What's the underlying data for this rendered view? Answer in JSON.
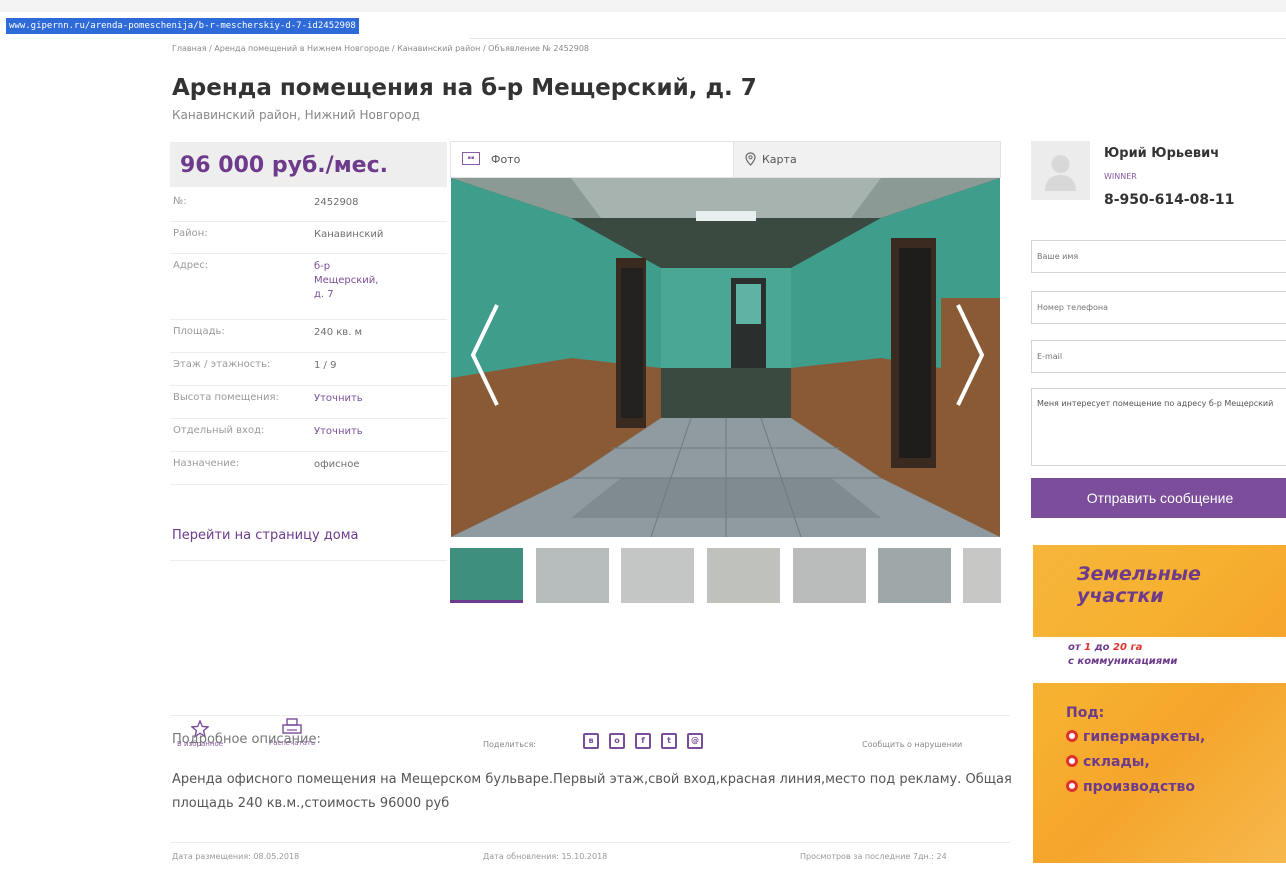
{
  "url": "www.gipernn.ru/arenda-pomeschenija/b-r-mescherskiy-d-7-id2452908",
  "breadcrumb": "Главная / Аренда помещений в Нижнем Новгороде / Канавинский район / Объявление № 2452908",
  "title": "Аренда помещения на б-р Мещерский, д. 7",
  "subtitle": "Канавинский район, Нижний Новгород",
  "price": "96 000 руб./мес.",
  "properties": [
    {
      "label": "№:",
      "value": "2452908",
      "link": false
    },
    {
      "label": "Район:",
      "value": "Канавинский",
      "link": false
    },
    {
      "label": "Адрес:",
      "value": "б-р Мещерский, д. 7",
      "link": true
    },
    {
      "label": "Площадь:",
      "value": "240 кв. м",
      "link": false
    },
    {
      "label": "Этаж / этажность:",
      "value": "1 / 9",
      "link": false
    },
    {
      "label": "Высота помещения:",
      "value": "Уточнить",
      "link": true
    },
    {
      "label": "Отдельный вход:",
      "value": "Уточнить",
      "link": true
    },
    {
      "label": "Назначение:",
      "value": "офисное",
      "link": false
    }
  ],
  "goto_house": "Перейти на страницу дома",
  "tabs": {
    "photo": "Фото",
    "map": "Карта"
  },
  "actions": {
    "favorite": "В избранное",
    "print": "Распечатать"
  },
  "share_label": "Поделиться:",
  "share_buttons": [
    "vk",
    "ok",
    "fb",
    "tw",
    "mail"
  ],
  "report": "Сообщить о нарушении",
  "description_heading": "Подробное описание:",
  "description": "Аренда офисного помещения на Мещерском бульваре.Первый этаж,свой вход,красная линия,место под рекламу. Общая площадь 240 кв.м.,стоимость 96000 руб",
  "footer": {
    "posted": "Дата размещения: 08.05.2018",
    "updated": "Дата обновления: 15.10.2018",
    "views": "Просмотров за последние 7дн.: 24"
  },
  "agent": {
    "name": "Юрий Юрьевич",
    "company": "WINNER",
    "phone": "8-950-614-08-11"
  },
  "form": {
    "name_placeholder": "Ваше имя",
    "phone_placeholder": "Номер телефона",
    "email_placeholder": "E-mail",
    "message": "Меня интересует помещение по адресу б-р Мещерский",
    "send": "Отправить сообщение"
  },
  "ad": {
    "title": "Земельные участки",
    "line1_prefix": "от ",
    "line1_a": "1",
    "line1_mid": " до ",
    "line1_b": "20 га",
    "line2": "с коммуникациями",
    "pod": "Под:",
    "items": [
      "гипермаркеты,",
      "склады,",
      "производство"
    ]
  },
  "colors": {
    "accent": "#6d3a8c",
    "button": "#7b4d9b",
    "ad_bg": "#f5b63b",
    "ad_red": "#e0322c"
  }
}
